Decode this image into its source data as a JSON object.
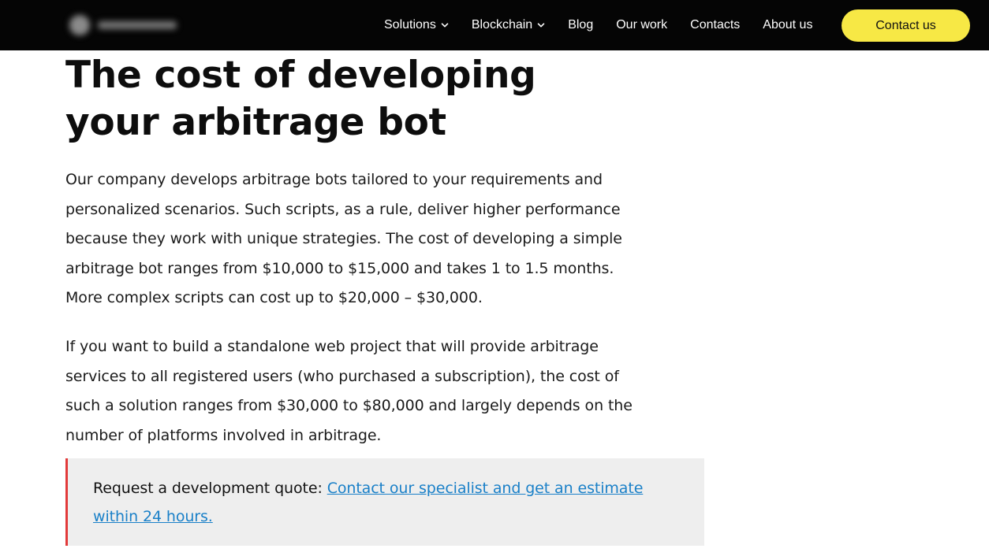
{
  "nav": {
    "items": [
      {
        "label": "Solutions",
        "dropdown": true
      },
      {
        "label": "Blockchain",
        "dropdown": true
      },
      {
        "label": "Blog",
        "dropdown": false
      },
      {
        "label": "Our work",
        "dropdown": false
      },
      {
        "label": "Contacts",
        "dropdown": false
      },
      {
        "label": "About us",
        "dropdown": false
      }
    ],
    "cta_label": "Contact us"
  },
  "article": {
    "title": "The cost of developing your arbitrage bot",
    "paragraphs": [
      "Our company develops arbitrage bots tailored to your requirements and personalized scenarios. Such scripts, as a rule, deliver higher performance because they work with unique strategies. The cost of developing a simple arbitrage bot ranges from $10,000 to $15,000 and takes 1 to 1.5 months. More complex scripts can cost up to $20,000 – $30,000.",
      "If you want to build a standalone web project that will provide arbitrage services to all registered users (who purchased a subscription), the cost of such a solution ranges from $30,000 to $80,000 and largely depends on the number of platforms involved in arbitrage."
    ],
    "callout": {
      "prefix": "Request a development quote: ",
      "link_text": "Contact our specialist and get an estimate within 24 hours."
    }
  },
  "colors": {
    "nav_bg": "#050505",
    "cta_bg": "#f7e845",
    "link": "#1a80c8",
    "callout_bg": "#eeeeee",
    "callout_border": "#e23a3a"
  }
}
